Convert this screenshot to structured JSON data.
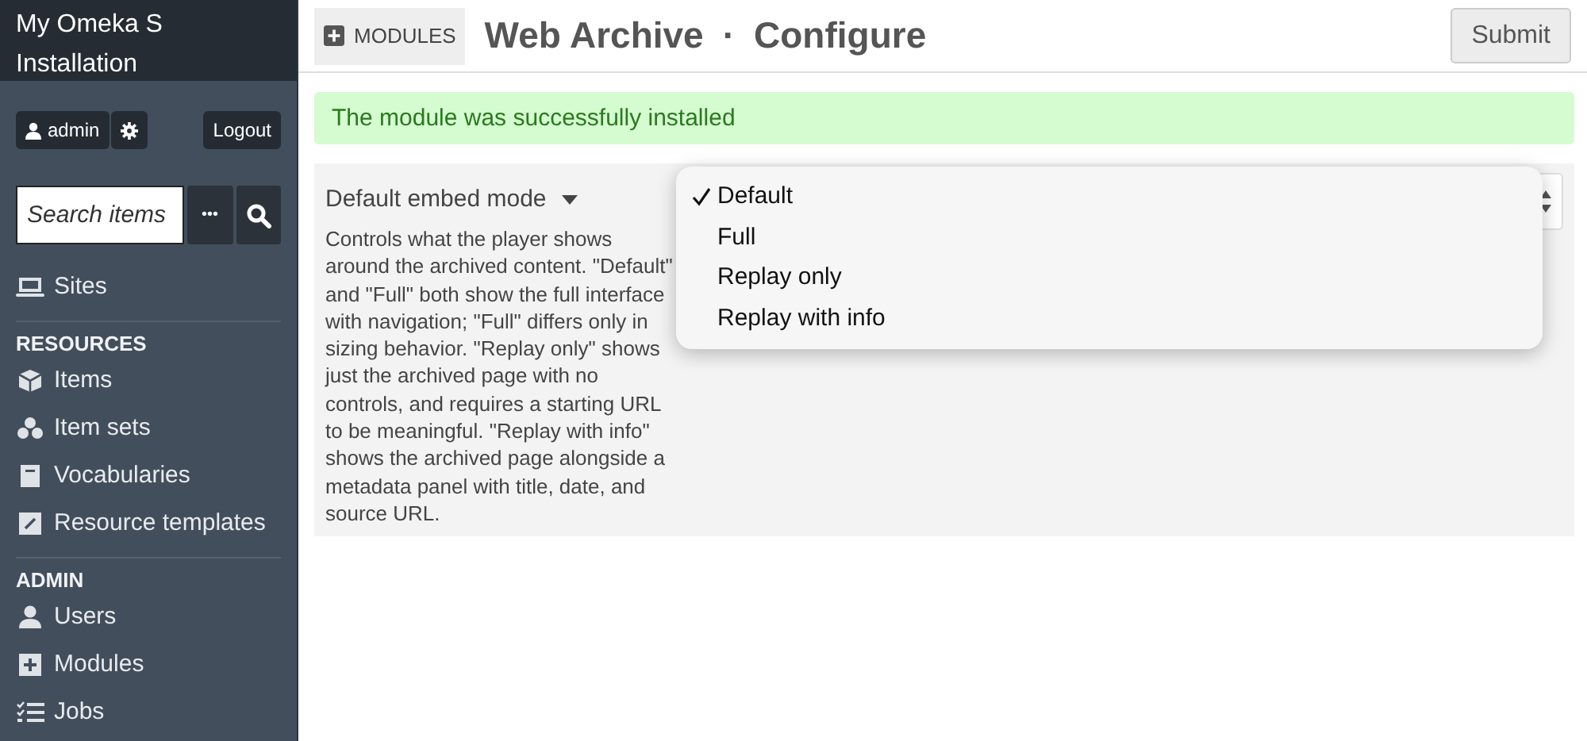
{
  "sidebar": {
    "title": "My Omeka S Installation",
    "user": "admin",
    "logout": "Logout",
    "search": {
      "placeholder": "Search items"
    },
    "more": "•••",
    "sections": [
      {
        "items": [
          {
            "label": "Sites"
          }
        ]
      },
      {
        "heading": "RESOURCES",
        "items": [
          {
            "label": "Items"
          },
          {
            "label": "Item sets"
          },
          {
            "label": "Vocabularies"
          },
          {
            "label": "Resource templates"
          }
        ]
      },
      {
        "heading": "ADMIN",
        "items": [
          {
            "label": "Users"
          },
          {
            "label": "Modules"
          },
          {
            "label": "Jobs"
          }
        ]
      }
    ]
  },
  "header": {
    "breadcrumb": "MODULES",
    "title": "Web Archive",
    "separator": "·",
    "subtitle": "Configure",
    "submit": "Submit"
  },
  "message": "The module was successfully installed",
  "field": {
    "label": "Default embed mode",
    "description": "Controls what the player shows around the archived content. \"Default\" and \"Full\" both show the full interface with navigation; \"Full\" differs only in sizing behavior. \"Replay only\" shows just the archived page with no controls, and requires a starting URL to be meaningful. \"Replay with info\" shows the archived page alongside a metadata panel with title, date, and source URL.",
    "options": [
      {
        "label": "Default",
        "selected": true
      },
      {
        "label": "Full",
        "selected": false
      },
      {
        "label": "Replay only",
        "selected": false
      },
      {
        "label": "Replay with info",
        "selected": false
      }
    ]
  }
}
